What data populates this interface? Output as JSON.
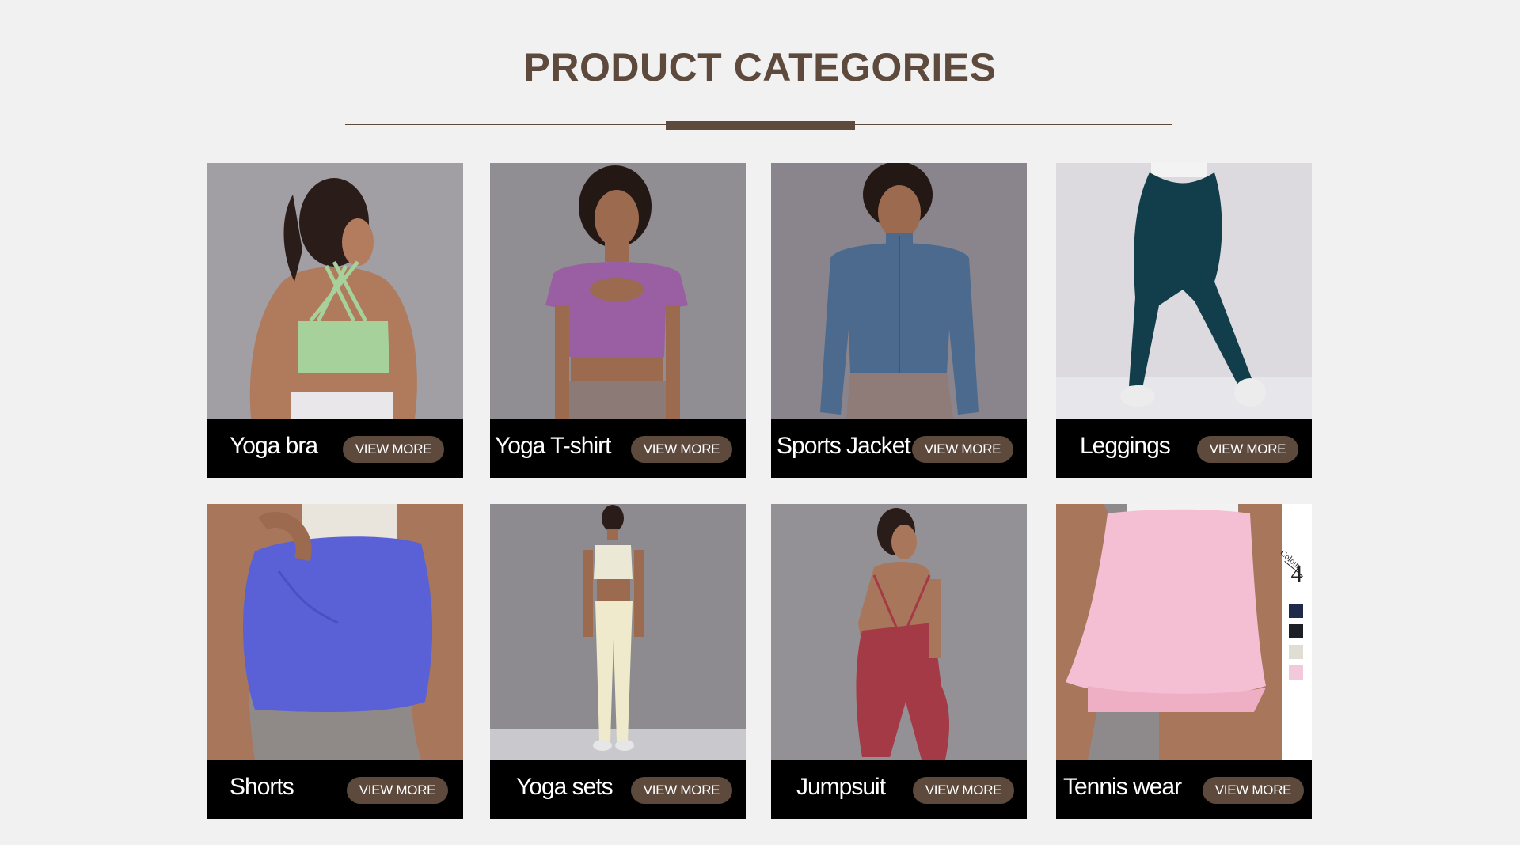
{
  "header": {
    "title": "PRODUCT CATEGORIES"
  },
  "theme": {
    "accent": "#5d4a3d",
    "caption_bg": "#000000",
    "page_bg": "#f1f1f1"
  },
  "categories": [
    {
      "label": "Yoga bra",
      "button": "VIEW MORE"
    },
    {
      "label": "Yoga T-shirt",
      "button": "VIEW MORE"
    },
    {
      "label": "Sports Jacket",
      "button": "VIEW MORE"
    },
    {
      "label": "Leggings",
      "button": "VIEW MORE"
    },
    {
      "label": "Shorts",
      "button": "VIEW MORE"
    },
    {
      "label": "Yoga sets",
      "button": "VIEW MORE"
    },
    {
      "label": "Jumpsuit",
      "button": "VIEW MORE"
    },
    {
      "label": "Tennis wear",
      "button": "VIEW MORE"
    }
  ],
  "tennis_colour_panel": {
    "word": "Colour",
    "count": "4",
    "swatches": [
      "#1f2a4a",
      "#1c1f26",
      "#e0ddd2",
      "#f2c9da"
    ]
  }
}
